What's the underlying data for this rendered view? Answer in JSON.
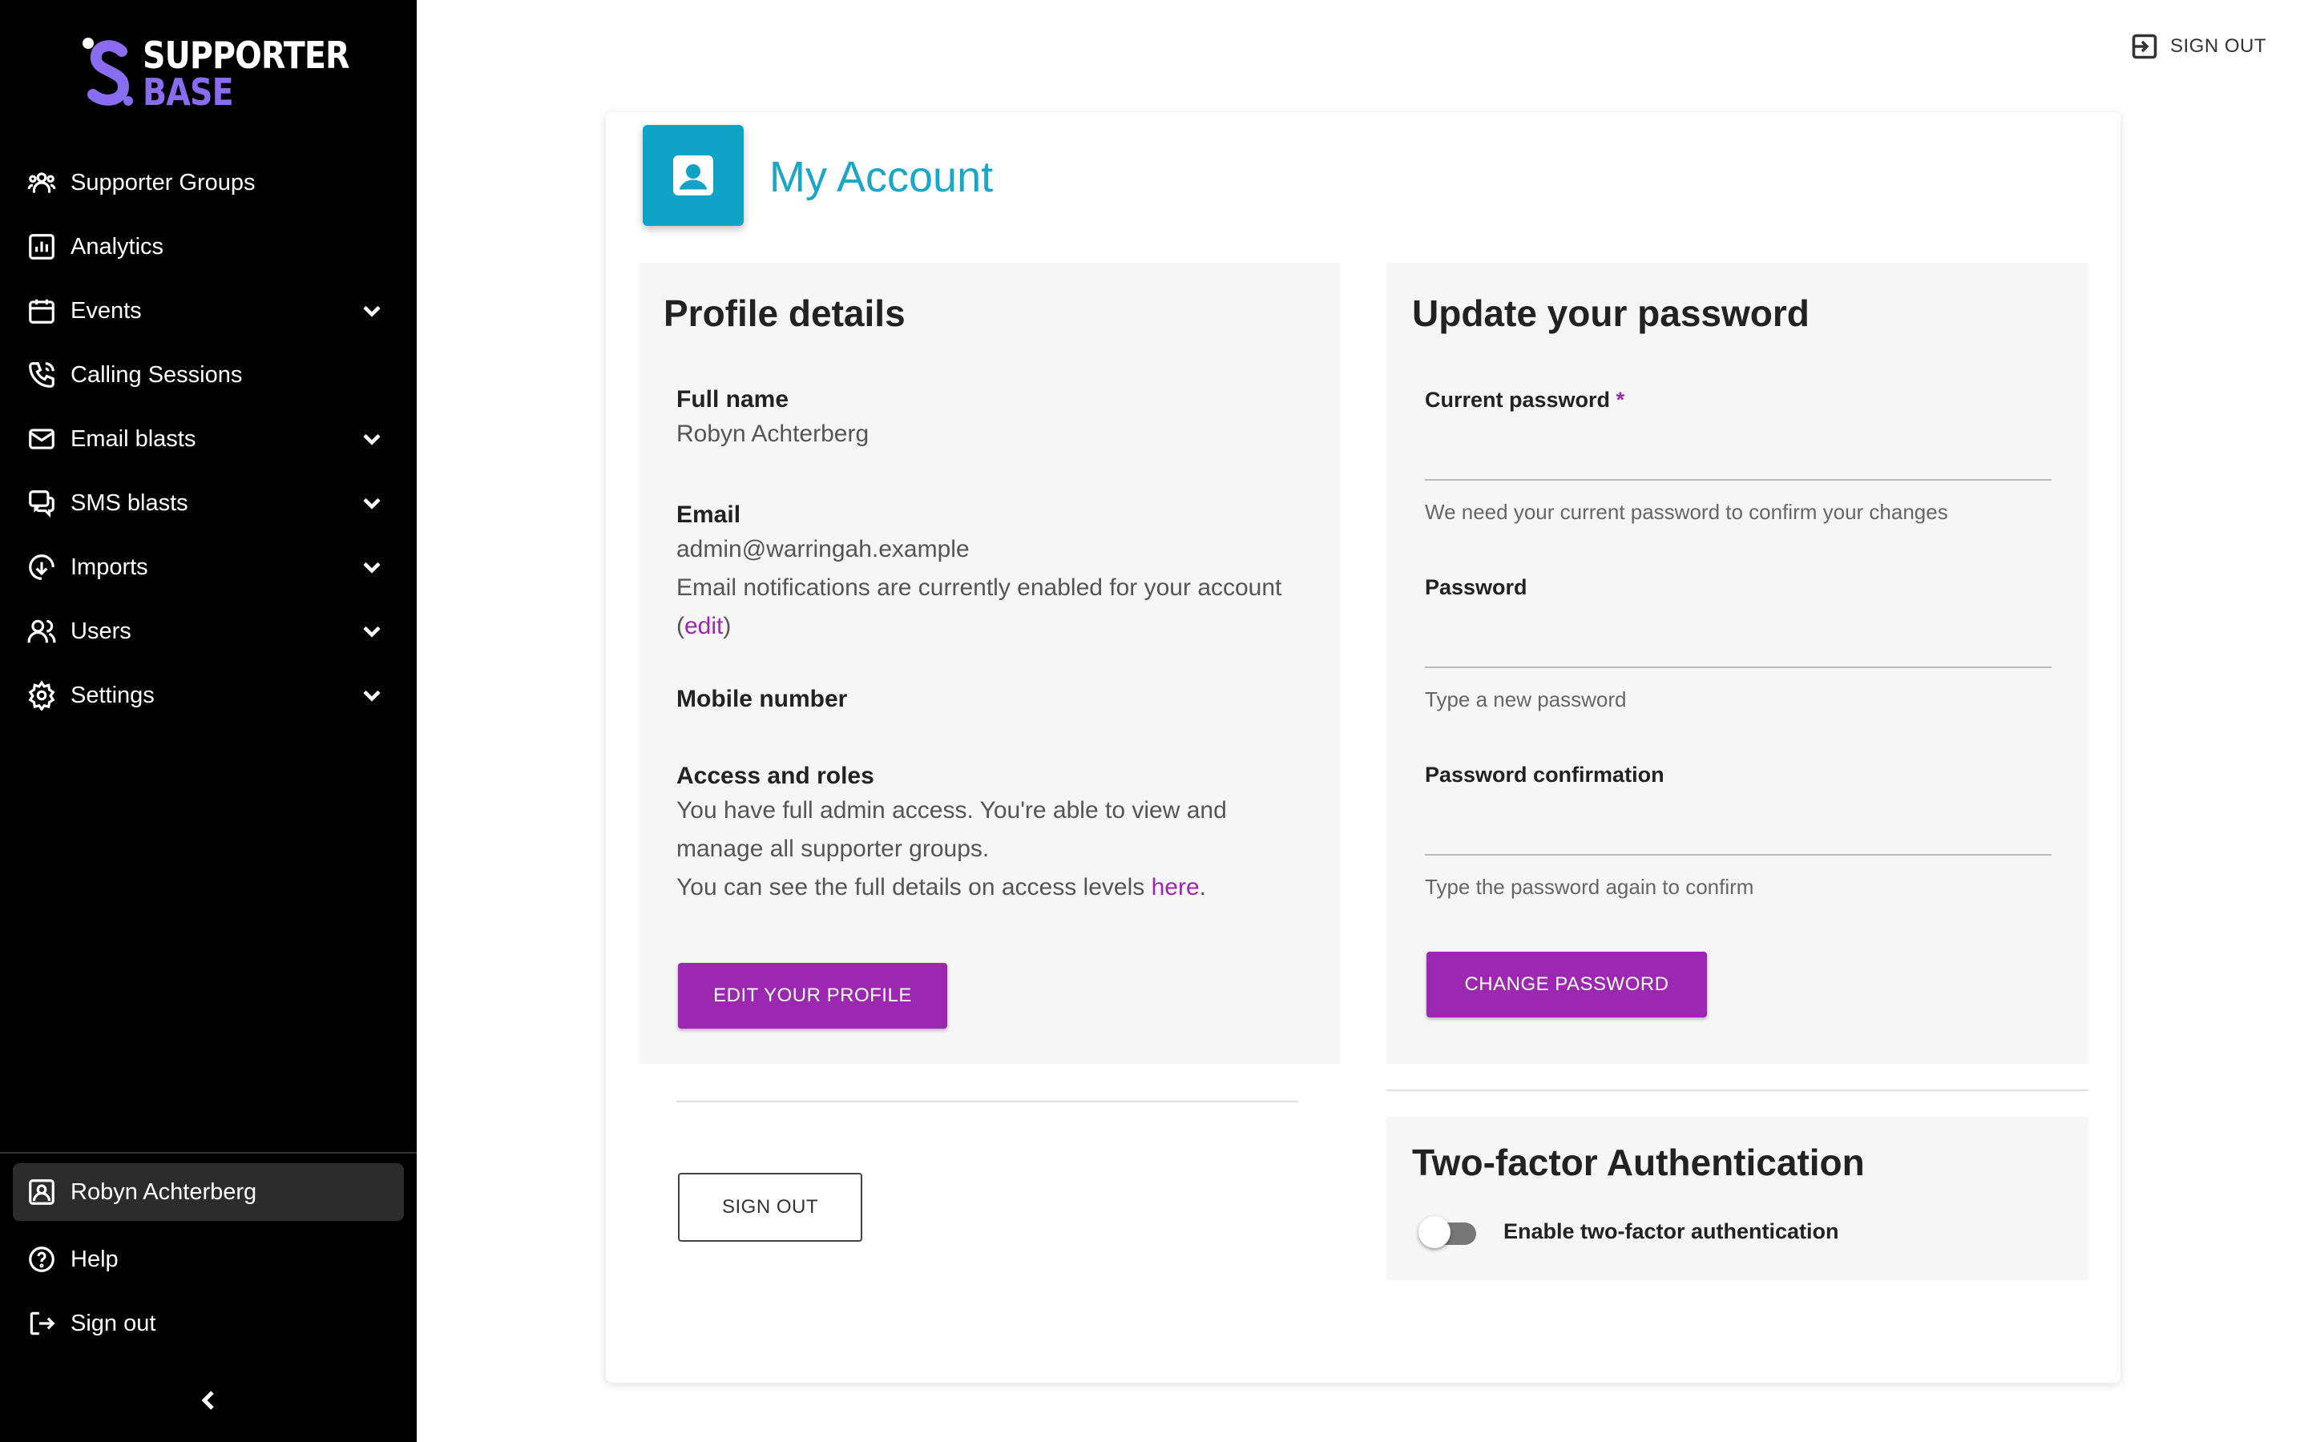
{
  "brand": {
    "line1": "SUPPORTER",
    "line2": "BASE",
    "accent": "#8a6cf0"
  },
  "sidebar": {
    "items": [
      {
        "label": "Supporter Groups",
        "icon": "people-group-icon",
        "expandable": false
      },
      {
        "label": "Analytics",
        "icon": "chart-icon",
        "expandable": false
      },
      {
        "label": "Events",
        "icon": "calendar-icon",
        "expandable": true
      },
      {
        "label": "Calling Sessions",
        "icon": "phone-icon",
        "expandable": false
      },
      {
        "label": "Email blasts",
        "icon": "mail-icon",
        "expandable": true
      },
      {
        "label": "SMS blasts",
        "icon": "chat-icon",
        "expandable": true
      },
      {
        "label": "Imports",
        "icon": "download-icon",
        "expandable": true
      },
      {
        "label": "Users",
        "icon": "users-icon",
        "expandable": true
      },
      {
        "label": "Settings",
        "icon": "gear-icon",
        "expandable": true
      }
    ],
    "bottom": [
      {
        "label": "Robyn Achterberg",
        "icon": "account-icon",
        "active": true
      },
      {
        "label": "Help",
        "icon": "help-icon",
        "active": false
      },
      {
        "label": "Sign out",
        "icon": "logout-icon",
        "active": false
      }
    ]
  },
  "header": {
    "sign_out": "SIGN OUT"
  },
  "page": {
    "title": "My Account",
    "accent": "#1aa6c9"
  },
  "profile": {
    "heading": "Profile details",
    "full_name_label": "Full name",
    "full_name": "Robyn Achterberg",
    "email_label": "Email",
    "email": "admin@warringah.example",
    "email_notice_1": "Email notifications are currently enabled for your account (",
    "email_notice_link": "edit",
    "email_notice_2": ")",
    "mobile_label": "Mobile number",
    "access_label": "Access and roles",
    "access_text": "You have full admin access. You're able to view and manage all supporter groups.",
    "access_more_1": "You can see the full details on access levels ",
    "access_more_link": "here",
    "access_more_2": ".",
    "edit_button": "EDIT YOUR PROFILE",
    "sign_out_button": "SIGN OUT"
  },
  "password": {
    "heading": "Update your password",
    "current_label": "Current password",
    "required_mark": "*",
    "current_help": "We need your current password to confirm your changes",
    "new_label": "Password",
    "new_help": "Type a new password",
    "confirm_label": "Password confirmation",
    "confirm_help": "Type the password again to confirm",
    "submit": "CHANGE PASSWORD"
  },
  "two_factor": {
    "heading": "Two-factor Authentication",
    "toggle_label": "Enable two-factor authentication",
    "enabled": false
  },
  "colors": {
    "primary": "#9c27b0",
    "sidebar_bg": "#000000"
  }
}
